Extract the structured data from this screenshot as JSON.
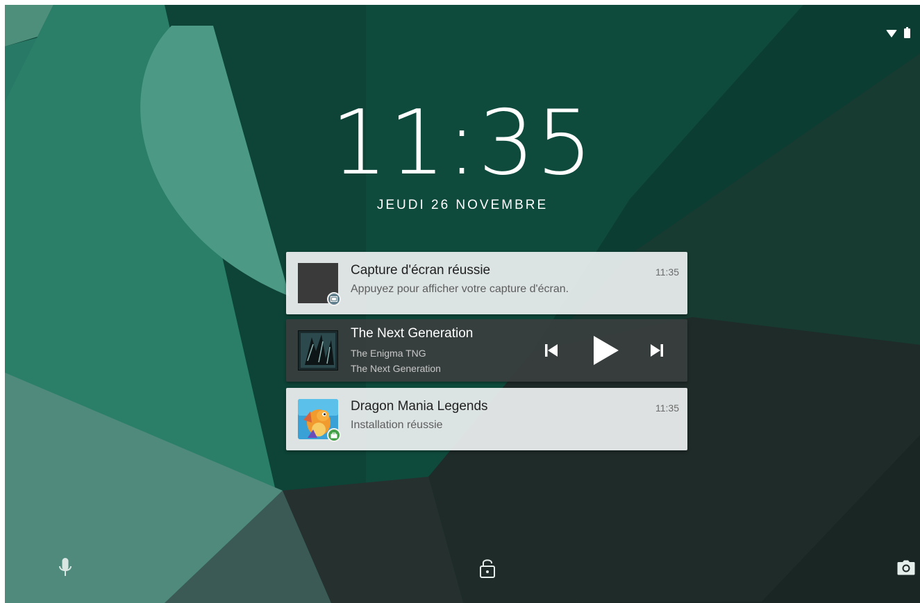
{
  "status_bar": {
    "wifi_icon": "wifi-icon",
    "battery_icon": "battery-icon"
  },
  "lockscreen": {
    "time": "11:35",
    "date": "JEUDI 26 NOVEMBRE"
  },
  "notifications": [
    {
      "title": "Capture d'écran réussie",
      "text": "Appuyez pour afficher votre capture d'écran.",
      "time": "11:35",
      "badge_icon": "screenshot-icon",
      "badge_color": "#607d8b"
    },
    {
      "title": "The Next Generation",
      "artist": "The Enigma TNG",
      "album": "The Next Generation",
      "controls": [
        "previous-icon",
        "play-icon",
        "next-icon"
      ]
    },
    {
      "title": "Dragon Mania Legends",
      "text": "Installation réussie",
      "time": "11:35",
      "badge_icon": "shop-icon",
      "badge_color": "#43a047"
    }
  ],
  "bottom_bar": {
    "left_icon": "mic-icon",
    "center_icon": "lock-open-icon",
    "right_icon": "camera-icon"
  },
  "colors": {
    "wallpaper_base": "#0e4a3c",
    "wallpaper_accent": "#2f8a74",
    "wallpaper_dark": "#1c2a27"
  }
}
